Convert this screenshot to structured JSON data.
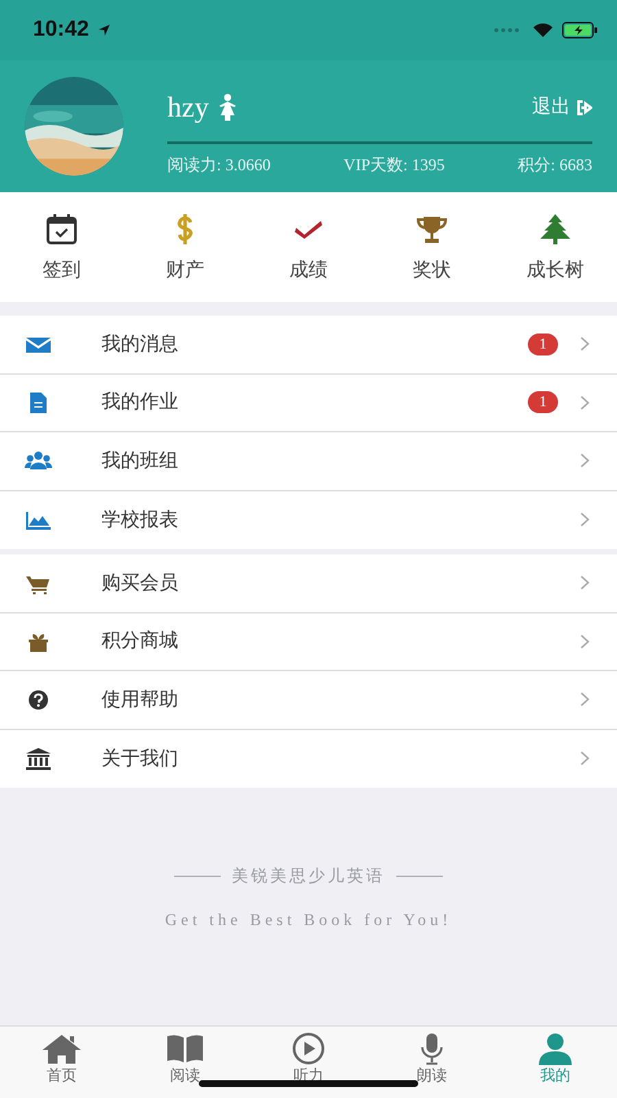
{
  "status_bar": {
    "time": "10:42"
  },
  "profile": {
    "name": "hzy",
    "logout": "退出",
    "stats": [
      "阅读力: 3.0660",
      "VIP天数: 1395",
      "积分: 6683"
    ]
  },
  "shortcuts": [
    {
      "label": "签到"
    },
    {
      "label": "财产"
    },
    {
      "label": "成绩"
    },
    {
      "label": "奖状"
    },
    {
      "label": "成长树"
    }
  ],
  "menu_groups": [
    [
      {
        "label": "我的消息",
        "badge": "1"
      },
      {
        "label": "我的作业",
        "badge": "1"
      },
      {
        "label": "我的班组"
      },
      {
        "label": "学校报表"
      }
    ],
    [
      {
        "label": "购买会员"
      },
      {
        "label": "积分商城"
      },
      {
        "label": "使用帮助"
      },
      {
        "label": "关于我们"
      }
    ]
  ],
  "footer": {
    "title": "美锐美思少儿英语",
    "slogan": "Get the Best Book for You!"
  },
  "tab_bar": [
    {
      "label": "首页",
      "selected": false
    },
    {
      "label": "阅读",
      "selected": false
    },
    {
      "label": "听力",
      "selected": false
    },
    {
      "label": "朗读",
      "selected": false
    },
    {
      "label": "我的",
      "selected": true
    }
  ]
}
